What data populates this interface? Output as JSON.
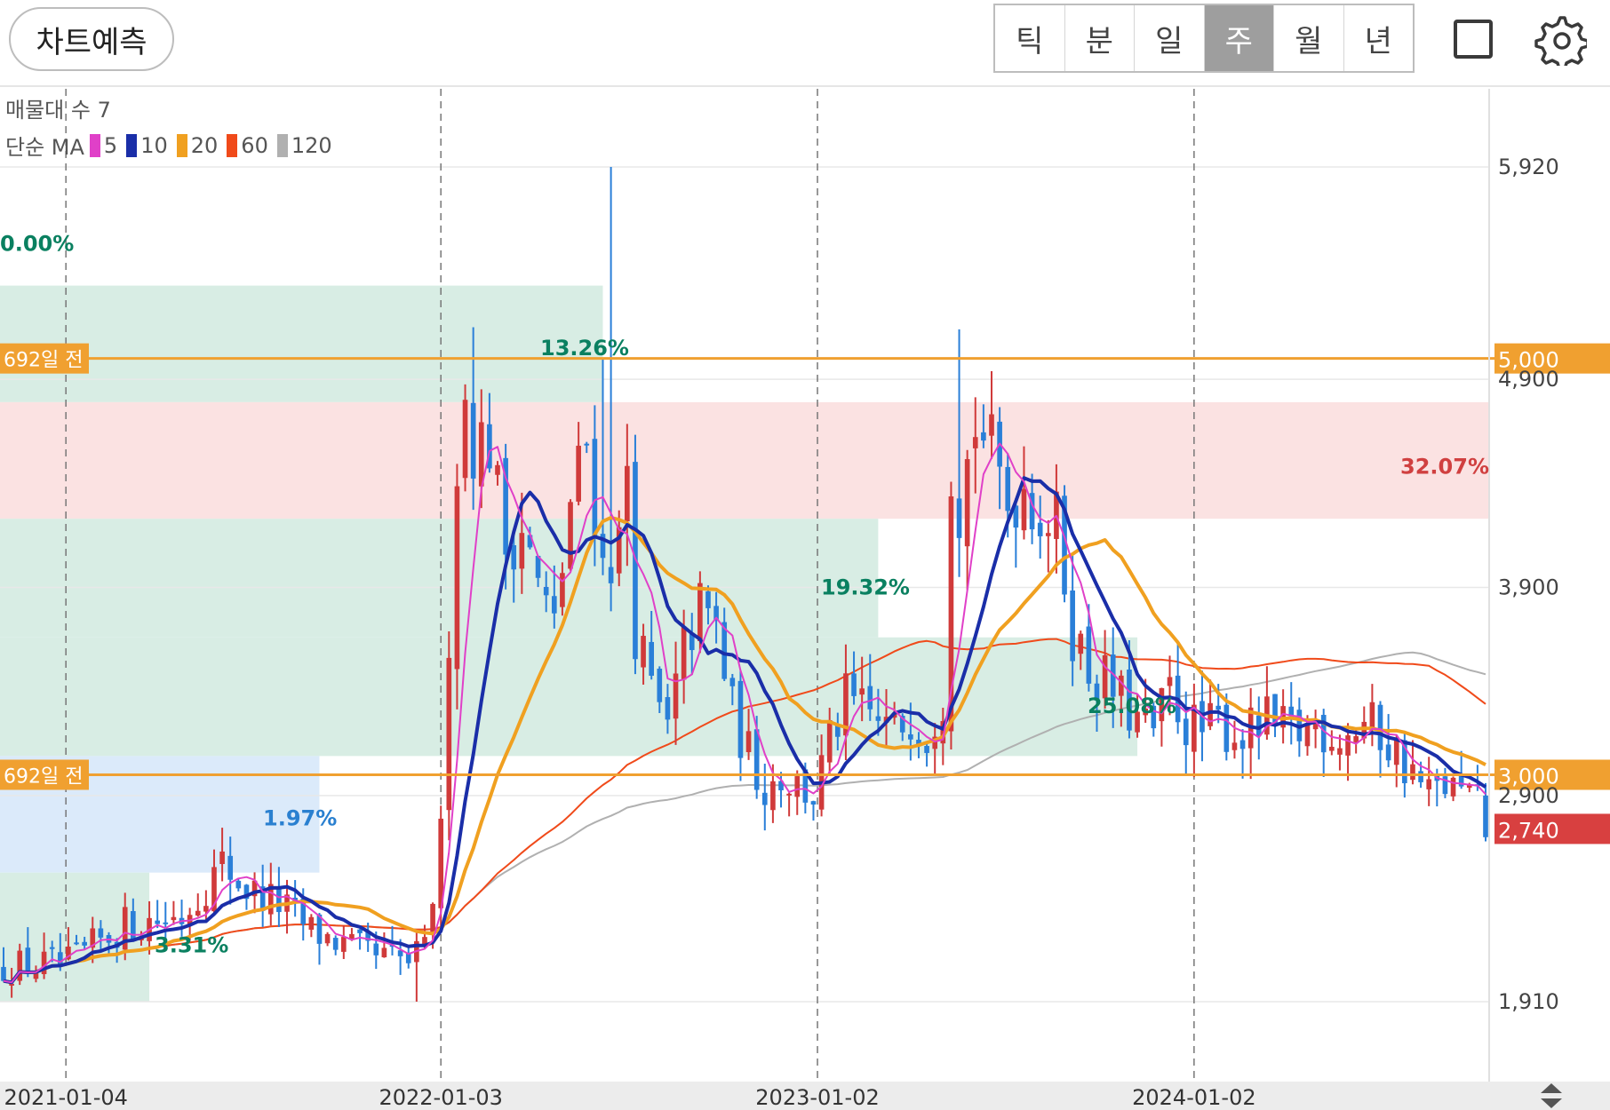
{
  "toolbar": {
    "predict_label": "차트예측",
    "periods": [
      "틱",
      "분",
      "일",
      "주",
      "월",
      "년"
    ],
    "active_period": "주",
    "fullscreen_icon": "square-icon",
    "settings_icon": "gear-icon"
  },
  "indicators": {
    "volume_profile_label": "매물대 수 7",
    "ma_title": "단순 MA",
    "ma_periods": [
      {
        "period": "5",
        "color": "#e040c8"
      },
      {
        "period": "10",
        "color": "#1a2ea8"
      },
      {
        "period": "20",
        "color": "#f0a020"
      },
      {
        "period": "60",
        "color": "#f04a1a"
      },
      {
        "period": "120",
        "color": "#b0b0b0"
      }
    ]
  },
  "chart_data": {
    "type": "candlestick",
    "x_ticks": [
      "2021-01-04",
      "2022-01-03",
      "2023-01-02",
      "2024-01-02"
    ],
    "y_ticks": [
      "5,920",
      "4,900",
      "3,900",
      "2,900",
      "1,910"
    ],
    "price_lines": [
      {
        "label": "692일 전",
        "price_label": "5,000",
        "color": "#f0a030"
      },
      {
        "label": "692일 전",
        "price_label": "3,000",
        "color": "#f0a030"
      }
    ],
    "current_price": {
      "label": "2,740",
      "color": "#d84040"
    },
    "pattern_percent_labels": [
      "0.00%",
      "13.26%",
      "19.32%",
      "25.08%",
      "3.31%",
      "1.97%",
      "32.07%"
    ],
    "colors": {
      "up": "#d03a3a",
      "down": "#2a7fd8",
      "zone_green": "#d8ede4",
      "zone_red": "#fbe2e2",
      "zone_blue": "#dbeafa"
    }
  }
}
